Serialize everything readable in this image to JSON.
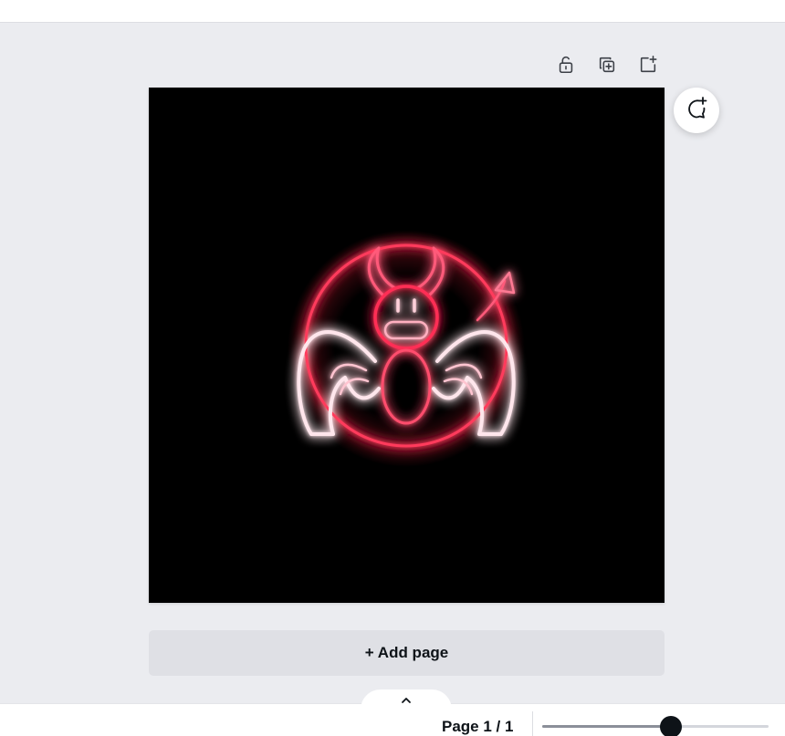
{
  "toolbar": {
    "icons": [
      "unlock-icon",
      "duplicate-page-icon",
      "add-page-icon"
    ]
  },
  "canvas": {
    "background": "#000000",
    "artwork": "neon-winged-devil-logo",
    "neon_color": "#ff2d55"
  },
  "comment": {
    "icon": "add-comment-icon"
  },
  "add_page": {
    "label": "+ Add page"
  },
  "footer": {
    "collapse_icon": "chevron-up-icon",
    "page_indicator": "Page 1 / 1",
    "zoom_level": 0.57
  },
  "colors": {
    "workspace": "#ebecf0",
    "text": "#0e1318",
    "button_bg": "#dfe0e5",
    "slider_thumb": "#0e1318"
  }
}
